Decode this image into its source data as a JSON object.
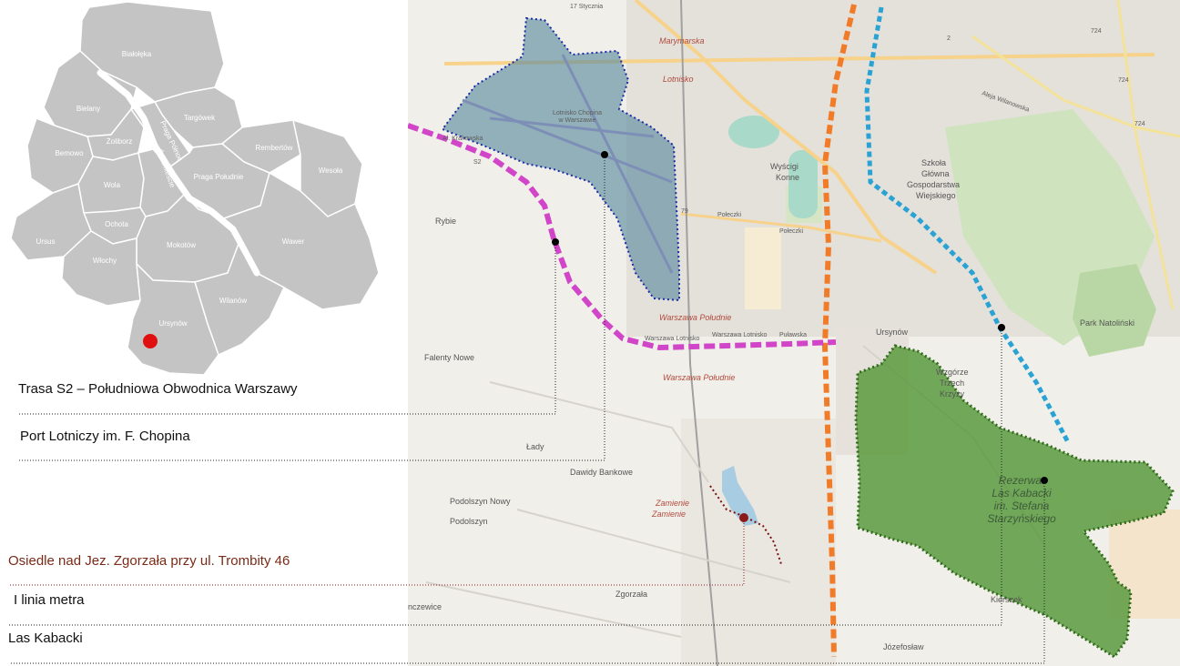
{
  "legend": {
    "s2": "Trasa S2 – Południowa Obwodnica Warszawy",
    "airport": "Port Lotniczy im. F. Chopina",
    "estate": "Osiedle nad Jez. Zgorzała przy ul. Trombity 46",
    "metro": "I linia metra",
    "forest": "Las Kabacki"
  },
  "districts": {
    "bialoleka": "Białołęka",
    "bielany": "Bielany",
    "targowek": "Targówek",
    "zoliborz": "Żoliborz",
    "praga_polnoc": "Praga Północ",
    "bemowo": "Bemowo",
    "rembertow": "Rembertów",
    "wesola": "Wesoła",
    "wola": "Wola",
    "srodmiescie": "Śródmieście",
    "praga_poludnie": "Praga Południe",
    "ochota": "Ochota",
    "ursus": "Ursus",
    "mokotow": "Mokotów",
    "wawer": "Wawer",
    "wlochy": "Włochy",
    "wilanow": "Wilanów",
    "ursynow": "Ursynów"
  },
  "places": {
    "rybie": "Rybie",
    "falenty_nowe": "Falenty Nowe",
    "lady": "Łady",
    "dawidy_bankowe": "Dawidy Bankowe",
    "podolszyn_nowy": "Podolszyn Nowy",
    "podolszyn": "Podolszyn",
    "zgorzala": "Zgorzała",
    "ursynow": "Ursynów",
    "jozefoslaw": "Józefosław",
    "kierszek": "Kierszek",
    "wzgorze": "Wzgórze",
    "trzech": "Trzech",
    "krzyzy": "Krzyży",
    "szkola": "Szkoła",
    "glowna": "Główna",
    "gospodarstwa": "Gospodarstwa",
    "wiejskiego": "Wiejskiego",
    "wyscigi": "Wyścigi",
    "konne": "Konne",
    "park_natolinski": "Park Natoliński",
    "marymarska": "Marymarska",
    "lotnisko": "Lotnisko",
    "krakowska": "Al. Krakowska",
    "poleczki": "Połeczki",
    "pulawska": "Puławska",
    "warszawa_poludnie": "Warszawa Południe",
    "warszawa_lotnisko": "Warszawa Lotnisko",
    "zamienie": "Zamienie",
    "czewice": "nczewice",
    "sty": "17 Stycznia",
    "wilanowska": "Aleja Wilanowska",
    "road_724": "724",
    "road_2": "2",
    "road_79": "79",
    "road_s2": "S2"
  },
  "forest_label": [
    "Rezerwat",
    "Las Kabacki",
    "im. Stefana",
    "Starzyńskiego"
  ],
  "airport_label": [
    "Lotnisko Chopina",
    "w Warszawie"
  ],
  "colors": {
    "district_fill": "#c4c4c4",
    "district_border": "#ffffff",
    "marker": "#e01010",
    "s2_route": "#d146c8",
    "metro_line": "#f07c2a",
    "tram_line": "#2aa3d4",
    "airport_fill": "#5f8ea0",
    "airport_border": "#1a2ca8",
    "forest_fill": "#5b9a3e",
    "forest_border": "#2f6b1a",
    "estate_marker": "#8b1a1a",
    "estate_path": "#7a1010"
  }
}
